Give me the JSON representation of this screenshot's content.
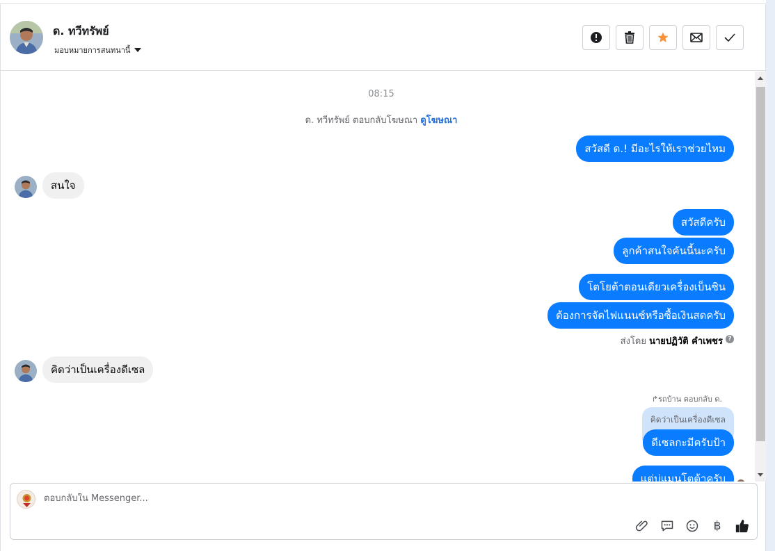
{
  "header": {
    "contact_name": "ด. ทวีทรัพย์",
    "assign_label": "มอบหมายการสนทนานี้",
    "actions": [
      {
        "name": "report-icon",
        "label": "Report"
      },
      {
        "name": "trash-icon",
        "label": "Delete"
      },
      {
        "name": "star-icon",
        "label": "Star"
      },
      {
        "name": "envelope-icon",
        "label": "Mark unread"
      },
      {
        "name": "check-icon",
        "label": "Done"
      }
    ],
    "star_color": "#f7923a"
  },
  "conversation": {
    "time": "08:15",
    "ad_note_text": "ด. ทวีทรัพย์ ตอบกลับโฆษณา",
    "ad_link": "ดูโฆษณา",
    "messages": {
      "m1": "สวัสดี ด.! มีอะไรให้เราช่วยไหม",
      "m2": "สนใจ",
      "m3": "สวัสดีครับ",
      "m4": "ลูกค้าสนใจคันนี้นะครับ",
      "m5": "โตโยต้าตอนเดียวเครื่องเบ็นซิน",
      "m6": "ต้องการจัดไฟแนนซ์หรือซื้อเงินสดครับ",
      "m7": "คิดว่าเป็นเครื่องดีเซล",
      "m8": "ดีเซลกะมีครับป้า",
      "m9": "แต่บ่แมนโตต้าครับ"
    },
    "sent_by_prefix": "ส่งโดย",
    "sent_by_name": "นายปฏิวัติ คำเพชร",
    "help_glyph": "?",
    "reply_note": "รถบ้าน ตอบกลับ ด.",
    "quoted_text": "คิดว่าเป็นเครื่องดีเซล",
    "bubble_out_color": "#0a7cff",
    "bubble_in_color": "#f0f0f0"
  },
  "composer": {
    "placeholder": "ตอบกลับใน Messenger...",
    "currency_symbol": "฿",
    "tools": [
      "paperclip-icon",
      "saved-reply-icon",
      "emoji-icon",
      "baht-icon",
      "thumbs-up-icon"
    ]
  }
}
